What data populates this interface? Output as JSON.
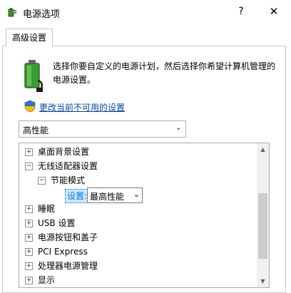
{
  "window": {
    "title": "电源选项",
    "help_label": "?",
    "close_label": "✕"
  },
  "tabs": [
    {
      "label": "高级设置"
    }
  ],
  "intro_text": "选择你要自定义的电源计划，然后选择你希望计算机管理的电源设置。",
  "change_link": "更改当前不可用的设置",
  "plan_select": {
    "value": "高性能"
  },
  "tree": {
    "items": [
      {
        "expander": "⊞",
        "label": "桌面背景设置"
      },
      {
        "expander": "⊟",
        "label": "无线适配器设置"
      },
      {
        "expander": "⊟",
        "label": "节能模式"
      },
      {
        "expander": "⊞",
        "label": "睡眠"
      },
      {
        "expander": "⊞",
        "label": "USB 设置"
      },
      {
        "expander": "⊞",
        "label": "电源按钮和盖子"
      },
      {
        "expander": "⊞",
        "label": "PCI Express"
      },
      {
        "expander": "⊞",
        "label": "处理器电源管理"
      },
      {
        "expander": "⊞",
        "label": "显示"
      }
    ],
    "setting_label": "设置:",
    "setting_value": "最高性能"
  },
  "colors": {
    "link": "#0645ad",
    "selection": "#cce8ff",
    "accent": "#0078d7"
  },
  "icons": {
    "app": "power-options-icon",
    "battery": "battery-plug-icon",
    "shield": "uac-shield-icon"
  }
}
